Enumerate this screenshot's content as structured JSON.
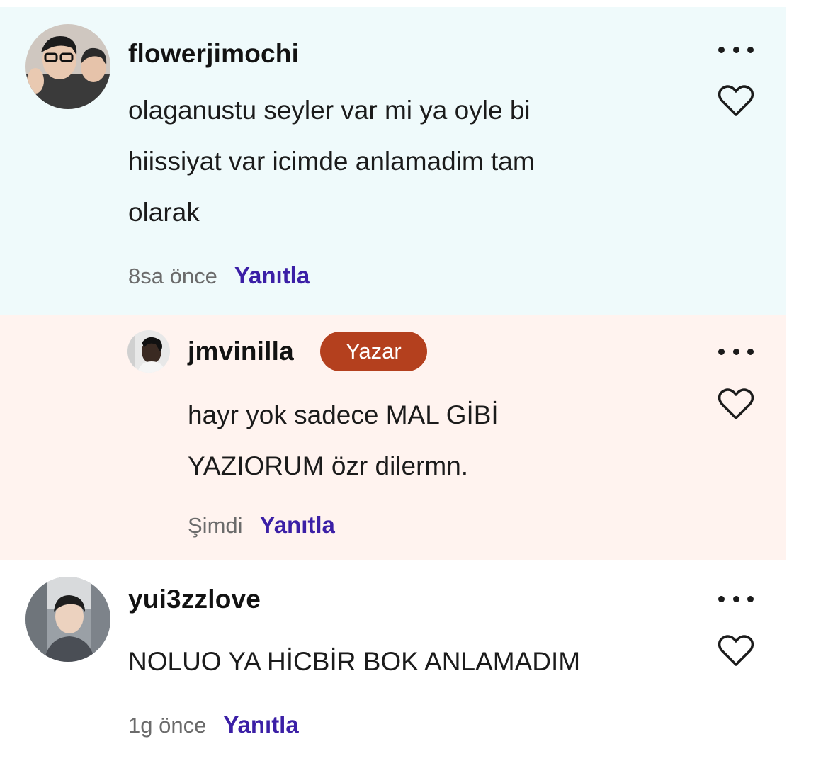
{
  "colors": {
    "parent_bg": "#effafb",
    "reply_bg": "#fff3ef",
    "author_badge_bg": "#b4401e",
    "reply_link": "#3b1fa6",
    "timestamp": "#6b6b6b"
  },
  "comments": [
    {
      "username": "flowerjimochi",
      "text_lines": [
        "olaganustu seyler var mi ya oyle bi",
        "hiissiyat var icimde anlamadim tam",
        "olarak"
      ],
      "time": "8sa önce",
      "reply_label": "Yanıtla",
      "icons": [
        "more-icon",
        "heart-icon"
      ]
    },
    {
      "username": "jmvinilla",
      "badge": "Yazar",
      "text_lines": [
        "hayr yok sadece MAL GİBİ",
        "YAZIORUM özr dilermn."
      ],
      "time": "Şimdi",
      "reply_label": "Yanıtla",
      "icons": [
        "more-icon",
        "heart-icon"
      ]
    },
    {
      "username": "yui3zzlove",
      "text_lines": [
        "NOLUO YA HİCBİR BOK ANLAMADIM"
      ],
      "time": "1g önce",
      "reply_label": "Yanıtla",
      "icons": [
        "more-icon",
        "heart-icon"
      ]
    }
  ]
}
